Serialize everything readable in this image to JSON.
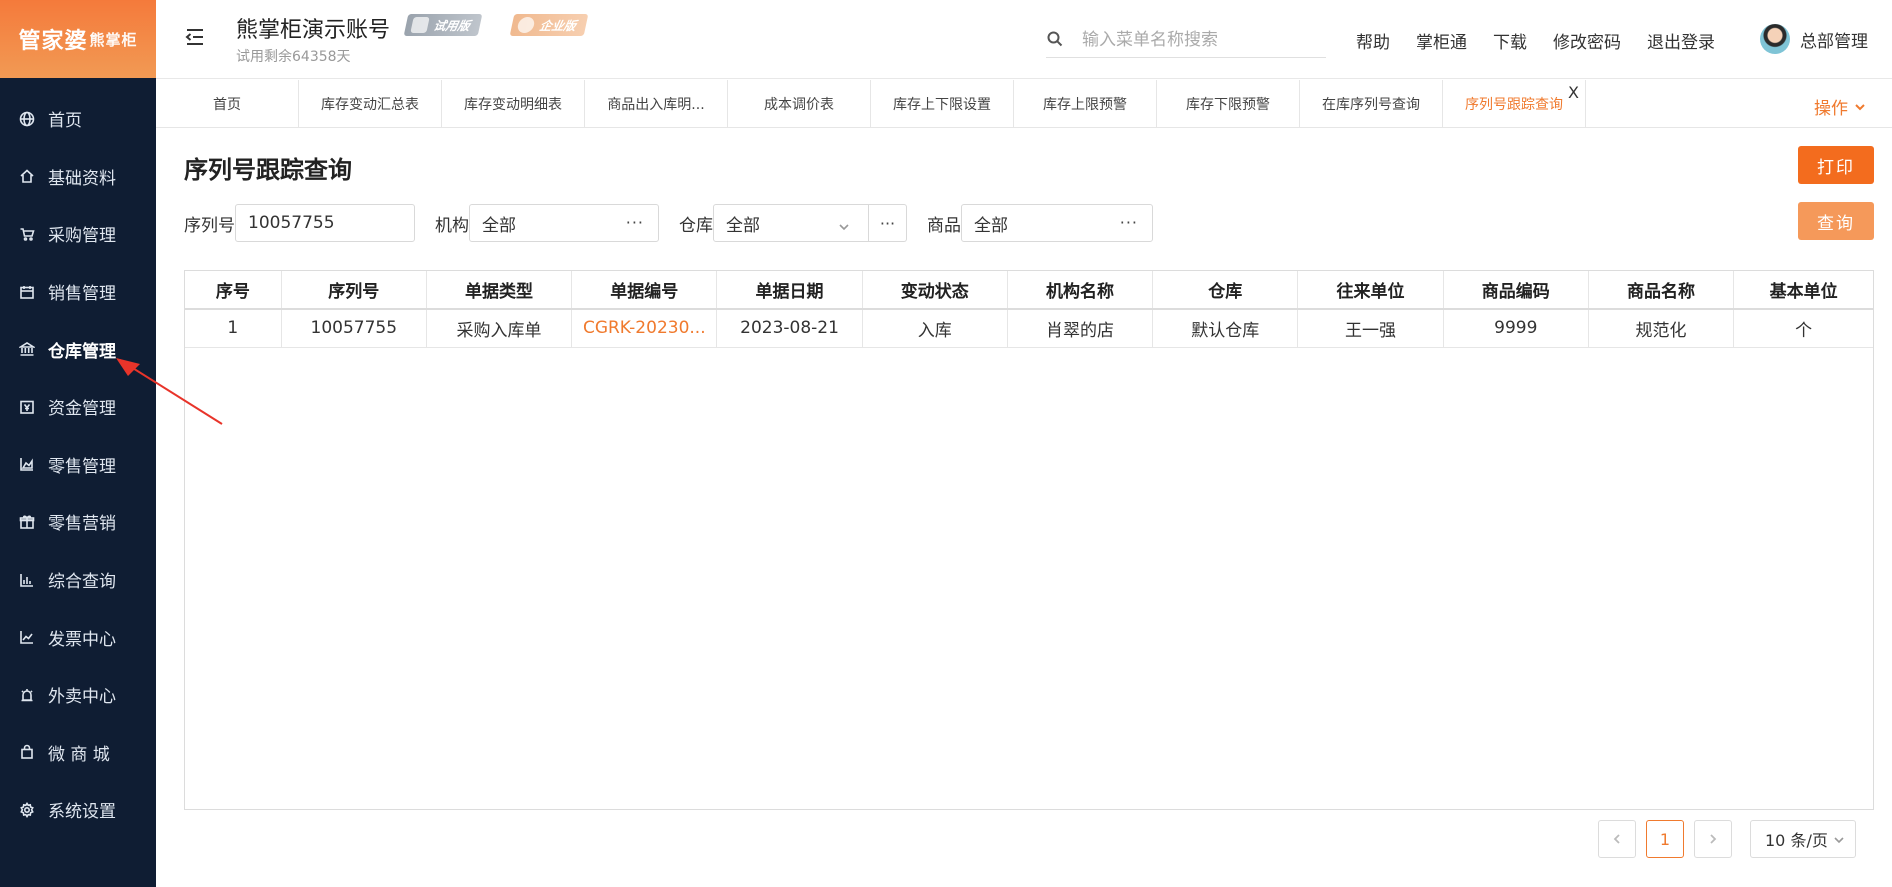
{
  "brand": {
    "logo_main": "管家婆",
    "logo_sub": "熊掌柜"
  },
  "sidebar": {
    "items": [
      {
        "label": "首页",
        "icon": "globe-icon"
      },
      {
        "label": "基础资料",
        "icon": "home-icon"
      },
      {
        "label": "采购管理",
        "icon": "cart-icon"
      },
      {
        "label": "销售管理",
        "icon": "calendar-icon"
      },
      {
        "label": "仓库管理",
        "icon": "bank-icon"
      },
      {
        "label": "资金管理",
        "icon": "wallet-icon"
      },
      {
        "label": "零售管理",
        "icon": "chart-area-icon"
      },
      {
        "label": "零售营销",
        "icon": "gift-icon"
      },
      {
        "label": "综合查询",
        "icon": "bar-chart-icon"
      },
      {
        "label": "发票中心",
        "icon": "trend-icon"
      },
      {
        "label": "外卖中心",
        "icon": "alarm-icon"
      },
      {
        "label": "微 商 城",
        "icon": "bag-icon"
      },
      {
        "label": "系统设置",
        "icon": "gear-icon"
      }
    ],
    "active_index": 4
  },
  "header": {
    "account_title": "熊掌柜演示账号",
    "trial_badge": "试用版",
    "enterprise_badge": "企业版",
    "trial_remaining": "试用剩余64358天",
    "search_placeholder": "输入菜单名称搜索",
    "links": [
      "帮助",
      "掌柜通",
      "下载",
      "修改密码",
      "退出登录"
    ],
    "user_name": "总部管理"
  },
  "tabs": {
    "items": [
      "首页",
      "库存变动汇总表",
      "库存变动明细表",
      "商品出入库明...",
      "成本调价表",
      "库存上下限设置",
      "库存上限预警",
      "库存下限预警",
      "在库序列号查询",
      "序列号跟踪查询"
    ],
    "active_index": 9,
    "close_label": "X",
    "ops_label": "操作"
  },
  "page": {
    "title": "序列号跟踪查询",
    "print_label": "打印",
    "query_label": "查询"
  },
  "filters": {
    "serial_label": "序列号",
    "serial_value": "10057755",
    "org_label": "机构",
    "org_value": "全部",
    "warehouse_label": "仓库",
    "warehouse_value": "全部",
    "product_label": "商品",
    "product_value": "全部",
    "dots": "···"
  },
  "table": {
    "headers": [
      "序号",
      "序列号",
      "单据类型",
      "单据编号",
      "单据日期",
      "变动状态",
      "机构名称",
      "仓库",
      "往来单位",
      "商品编码",
      "商品名称",
      "基本单位"
    ],
    "rows": [
      [
        "1",
        "10057755",
        "采购入库单",
        "CGRK-20230...",
        "2023-08-21",
        "入库",
        "肖翠的店",
        "默认仓库",
        "王一强",
        "9999",
        "规范化",
        "个"
      ]
    ]
  },
  "pager": {
    "current_page": "1",
    "page_size": "10 条/页"
  },
  "colors": {
    "accent": "#f07a2e",
    "sidebar_bg": "#0f1d33",
    "annotation_arrow": "#e8342a"
  }
}
